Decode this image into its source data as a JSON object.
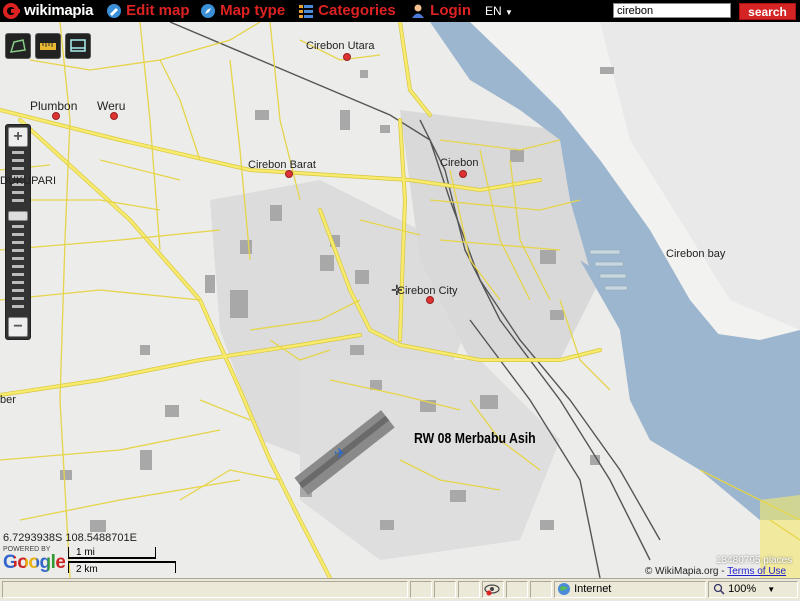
{
  "header": {
    "logo_text": "wikimapia",
    "edit_map": "Edit map",
    "map_type": "Map type",
    "categories": "Categories",
    "login": "Login",
    "language": "EN",
    "search_value": "cirebon",
    "search_button": "search"
  },
  "map": {
    "places": [
      {
        "name": "Cirebon Utara"
      },
      {
        "name": "Plumbon"
      },
      {
        "name": "Weru"
      },
      {
        "name": "Cirebon Barat"
      },
      {
        "name": "Cirebon"
      },
      {
        "name": "DUKUPARI"
      },
      {
        "name": "Cirebon bay"
      },
      {
        "name": "Cirebon City"
      },
      {
        "name": "ber"
      }
    ],
    "highlight_label": "RW 08 Merbabu Asih",
    "coordinates": "6.7293938S 108.5488701E",
    "powered_by": "POWERED BY",
    "google_logo": "Google",
    "scale_mi": "1 mi",
    "scale_km": "2 km",
    "place_count": "13480795 places",
    "copyright": "© WikiMapia.org -",
    "terms_link": "Terms of Use"
  },
  "statusbar": {
    "zone": "Internet",
    "zoom": "100%"
  },
  "colors": {
    "road": "#f5e96a",
    "road_edge": "#d9c640",
    "water": "#99b3cc",
    "land": "#ececea",
    "urban": "#d8d8d8",
    "building": "#9a9a9a",
    "accent": "#d42424"
  }
}
